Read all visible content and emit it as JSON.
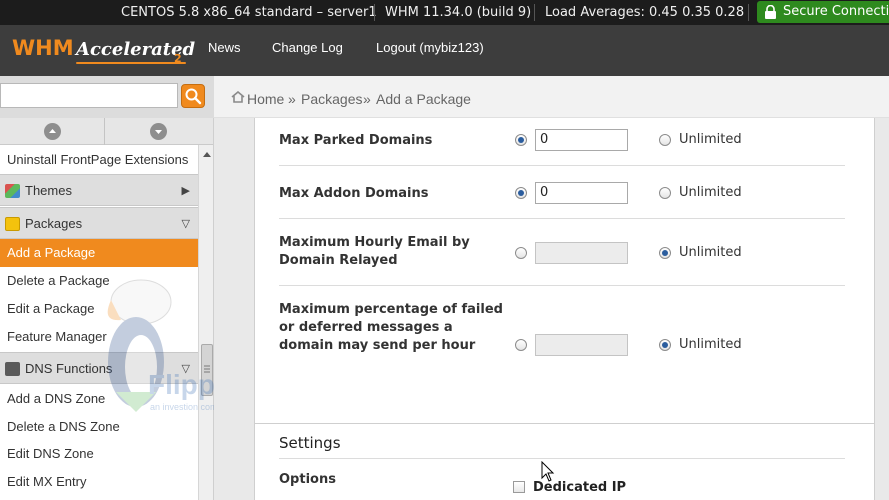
{
  "status_bar": {
    "os": "CENTOS 5.8 x86_64 standard – server1",
    "whm_version": "WHM 11.34.0 (build 9)",
    "load": "Load Averages: 0.45 0.35 0.28",
    "secure": "Secure Connection"
  },
  "header": {
    "logo_whm": "WHM",
    "logo_accelerated": "Accelerated",
    "logo_suffix": "2",
    "nav": [
      "News",
      "Change Log",
      "Logout (mybiz123)"
    ]
  },
  "search": {
    "placeholder": ""
  },
  "breadcrumb": {
    "home": "Home",
    "sep": "»",
    "packages": "Packages",
    "current": "Add a Package"
  },
  "sidebar": {
    "top_item": "Uninstall FrontPage Extensions",
    "themes": "Themes",
    "packages": "Packages",
    "package_items": [
      "Add a Package",
      "Delete a Package",
      "Edit a Package",
      "Feature Manager"
    ],
    "dns": "DNS Functions",
    "dns_items": [
      "Add a DNS Zone",
      "Delete a DNS Zone",
      "Edit DNS Zone",
      "Edit MX Entry"
    ]
  },
  "watermark": {
    "brand": "FlipperHost",
    "tagline": "an investion company"
  },
  "form": {
    "rows": [
      {
        "label": "Max Parked Domains",
        "value": "0",
        "unlimited": "Unlimited",
        "selected": "value"
      },
      {
        "label": "Max Addon Domains",
        "value": "0",
        "unlimited": "Unlimited",
        "selected": "value"
      },
      {
        "label": "Maximum Hourly Email by Domain Relayed",
        "value": "",
        "unlimited": "Unlimited",
        "selected": "unlimited"
      },
      {
        "label": "Maximum percentage of failed or deferred messages a domain may send per hour",
        "value": "",
        "unlimited": "Unlimited",
        "selected": "unlimited"
      }
    ]
  },
  "settings": {
    "title": "Settings",
    "options_label": "Options",
    "dedicated_ip": "Dedicated IP",
    "dedicated_ip_checked": false
  },
  "colors": {
    "accent": "#f08a1e",
    "header_bg": "#3d3d3d",
    "status_bg": "#1c1c1c",
    "secure_bg": "#2e8a1e"
  }
}
